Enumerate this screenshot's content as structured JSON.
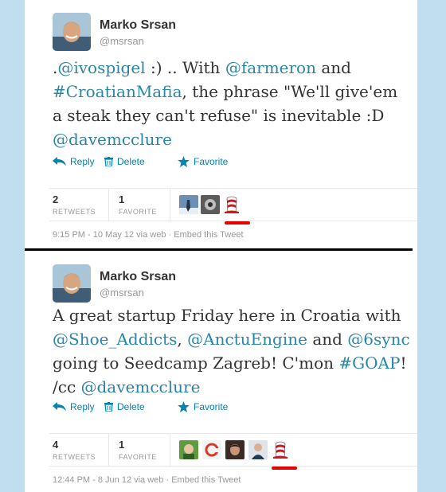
{
  "tweets": [
    {
      "author": {
        "name": "Marko Srsan",
        "handle": "@msrsan"
      },
      "text_parts": [
        ".",
        "@ivospigel",
        " :) .. With ",
        "@farmeron",
        " and ",
        "#CroatianMafia",
        ", the phrase \"We'll give'em a steak they can't refuse\" is inevitable :D ",
        "@davemcclure"
      ],
      "actions": {
        "reply": "Reply",
        "delete": "Delete",
        "favorite": "Favorite"
      },
      "stats": {
        "retweets": {
          "count": "2",
          "label": "RETWEETS"
        },
        "favorites": {
          "count": "1",
          "label": "FAVORITE"
        }
      },
      "meta": {
        "timestamp": "9:15 PM - 10 May 12 via web",
        "separator": "·",
        "embed": "Embed this Tweet"
      }
    },
    {
      "author": {
        "name": "Marko Srsan",
        "handle": "@msrsan"
      },
      "text_parts": [
        "A great startup Friday here in Croatia with ",
        "@Shoe_Addicts",
        ", ",
        "@AnctuEngine",
        " and ",
        "@6sync",
        " going to Seedcamp Zagreb! C'mon ",
        "#GOAP",
        "! /cc ",
        "@davemcclure"
      ],
      "actions": {
        "reply": "Reply",
        "delete": "Delete",
        "favorite": "Favorite"
      },
      "stats": {
        "retweets": {
          "count": "4",
          "label": "RETWEETS"
        },
        "favorites": {
          "count": "1",
          "label": "FAVORITE"
        }
      },
      "meta": {
        "timestamp": "12:44 PM - 8 Jun 12 via web",
        "separator": "·",
        "embed": "Embed this Tweet"
      }
    }
  ],
  "icons": {
    "reply": "reply-arrow-icon",
    "delete": "trash-icon",
    "favorite": "star-icon"
  },
  "colors": {
    "link": "#2a85a6",
    "action": "#0084b4",
    "highlight_mark": "#e60000",
    "background": "#c0deed"
  }
}
